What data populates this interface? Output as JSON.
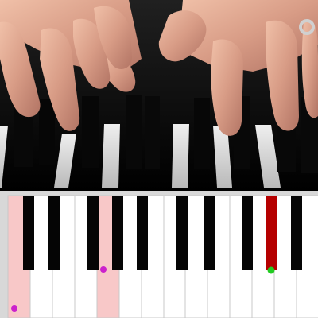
{
  "keyboard": {
    "highlighted_white_keys": [
      0,
      4
    ],
    "active_black_key": 8,
    "highlight_color": "#F8C8C8",
    "active_black_color": "#B50000",
    "markers": [
      {
        "type": "white",
        "key": 0,
        "color": "#CC22CC"
      },
      {
        "type": "white",
        "key": 4,
        "color": "#CC22CC"
      },
      {
        "type": "black",
        "key": 8,
        "color": "#22CC22"
      }
    ]
  }
}
